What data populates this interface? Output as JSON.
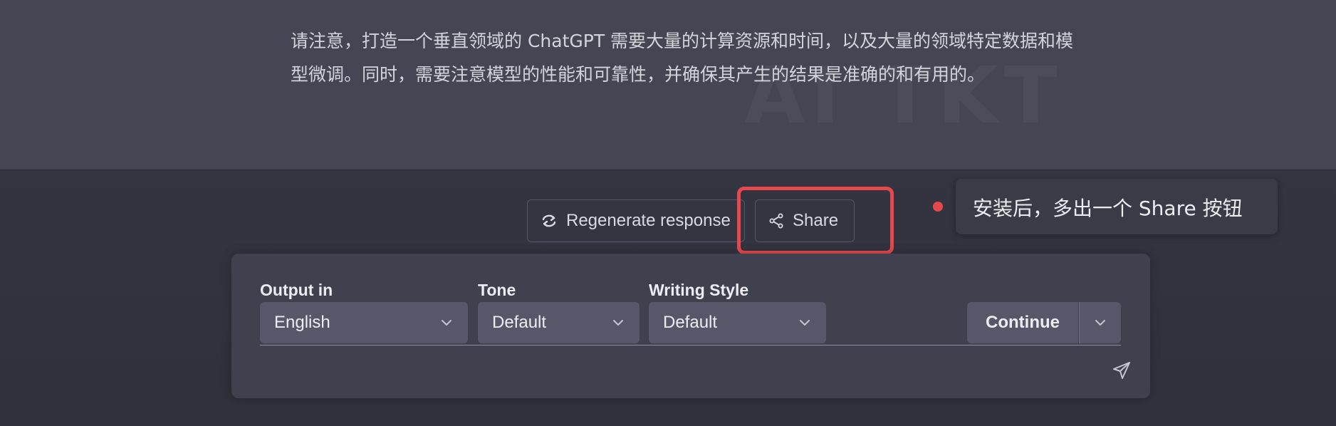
{
  "watermark": "AI TKT",
  "message": {
    "text": "请注意，打造一个垂直领域的 ChatGPT 需要大量的计算资源和时间，以及大量的领域特定数据和模型微调。同时，需要注意模型的性能和可靠性，并确保其产生的结果是准确的和有用的。"
  },
  "actions": {
    "regenerate_label": "Regenerate response",
    "share_label": "Share"
  },
  "annotation": {
    "text": "安装后，多出一个 Share 按钮",
    "highlight_color": "#e5484d"
  },
  "toolbar": {
    "output_label": "Output in",
    "output_value": "English",
    "tone_label": "Tone",
    "tone_value": "Default",
    "style_label": "Writing Style",
    "style_value": "Default",
    "continue_label": "Continue"
  },
  "prompt": {
    "placeholder": ""
  },
  "icons": {
    "regenerate": "refresh-icon",
    "share": "share-icon",
    "dropdown": "chevron-down-icon",
    "send": "send-icon"
  },
  "colors": {
    "background": "#343541",
    "message_background": "#444654",
    "panel": "#40414f",
    "control": "#565869",
    "accent_red": "#e5484d"
  }
}
